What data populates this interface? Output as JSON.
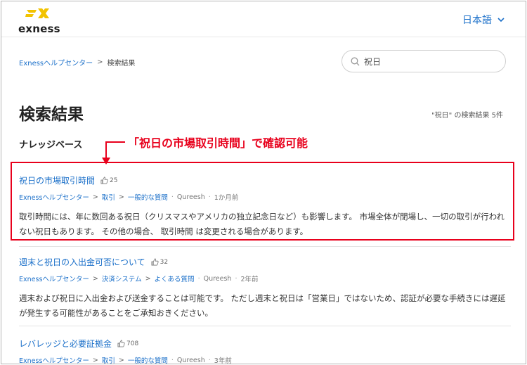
{
  "header": {
    "logo_text": "exness",
    "language": "日本語"
  },
  "breadcrumb": {
    "home": "Exnessヘルプセンター",
    "separator": ">",
    "current": "検索結果"
  },
  "search": {
    "value": "祝日"
  },
  "page": {
    "title": "検索結果",
    "result_count": "\"祝日\" の検索結果 5件",
    "section": "ナレッジベース"
  },
  "annotation": {
    "text": "「祝日の市場取引時間」で確認可能"
  },
  "results": [
    {
      "title": "祝日の市場取引時間",
      "votes": "25",
      "path": [
        "Exnessヘルプセンター",
        "取引",
        "一般的な質問"
      ],
      "author": "Qureesh",
      "time": "1か月前",
      "desc": "取引時間には、年に数回ある祝日（クリスマスやアメリカの独立記念日など）も影響します。 市場全体が閉場し、一切の取引が行われない祝日もあります。 その他の場合、 取引時間 は変更される場合があります。"
    },
    {
      "title": "週末と祝日の入出金可否について",
      "votes": "32",
      "path": [
        "Exnessヘルプセンター",
        "決済システム",
        "よくある質問"
      ],
      "author": "Qureesh",
      "time": "2年前",
      "desc": "週末および祝日に入出金および送金することは可能です。 ただし週末と祝日は「営業日」ではないため、認証が必要な手続きには遅延が発生する可能性があることをご承知おきください。"
    },
    {
      "title": "レバレッジと必要証拠金",
      "votes": "708",
      "path": [
        "Exnessヘルプセンター",
        "取引",
        "一般的な質問"
      ],
      "author": "Qureesh",
      "time": "3年前",
      "desc": ""
    }
  ],
  "colors": {
    "link": "#1a6fc9",
    "annotation": "#e8001c",
    "logo": "#f2c300"
  }
}
